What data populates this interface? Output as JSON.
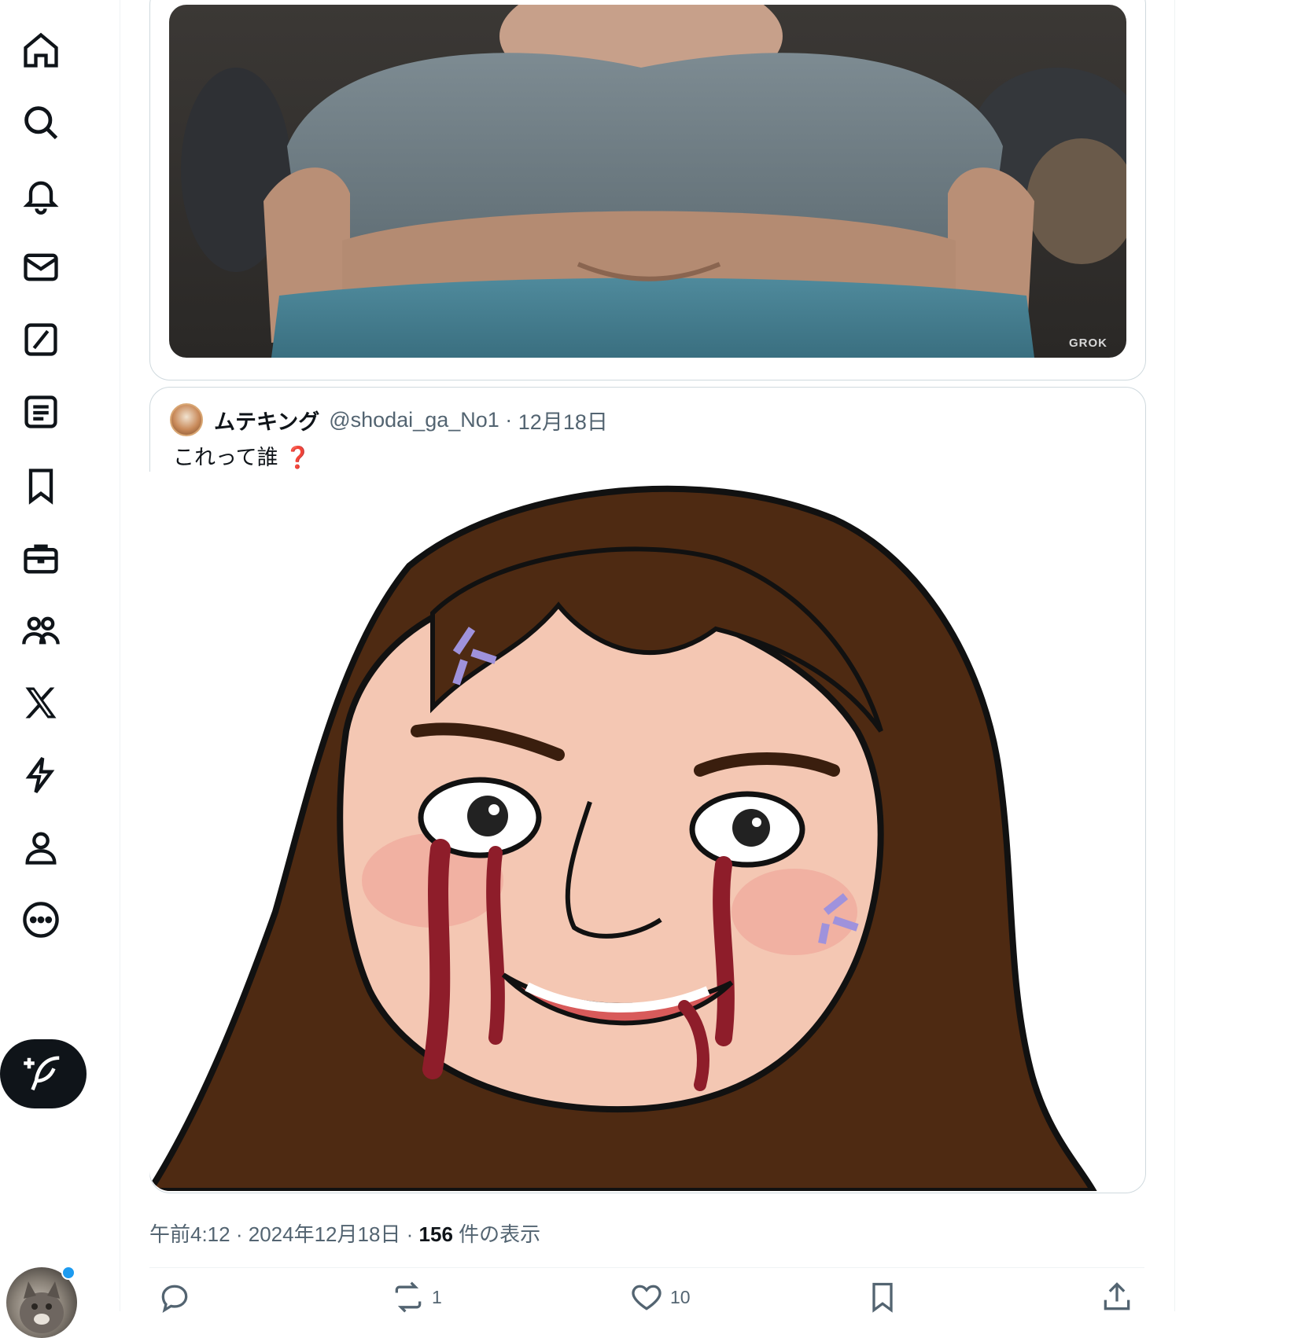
{
  "nav": {
    "items": [
      {
        "name": "home-icon"
      },
      {
        "name": "search-icon"
      },
      {
        "name": "notifications-icon"
      },
      {
        "name": "messages-icon"
      },
      {
        "name": "grok-icon"
      },
      {
        "name": "lists-icon"
      },
      {
        "name": "bookmarks-icon"
      },
      {
        "name": "jobs-icon"
      },
      {
        "name": "communities-icon"
      },
      {
        "name": "premium-x-icon"
      },
      {
        "name": "verified-orgs-icon"
      },
      {
        "name": "profile-icon"
      },
      {
        "name": "more-icon"
      }
    ],
    "compose_icon": "compose-feather-icon"
  },
  "top_image": {
    "watermark": "GROK"
  },
  "quote": {
    "display_name": "ムテキング",
    "handle": "@shodai_ga_No1",
    "date": "12月18日",
    "text": "これって誰",
    "emoji": "❓"
  },
  "post": {
    "time": "午前4:12",
    "date": "2024年12月18日",
    "views_count": "156",
    "views_label": "件の表示"
  },
  "actions": {
    "reply_count": "",
    "repost_count": "1",
    "like_count": "10"
  },
  "colors": {
    "text_primary": "#0f1419",
    "text_secondary": "#536471",
    "border": "#cfd9de",
    "accent": "#1d9bf0"
  }
}
